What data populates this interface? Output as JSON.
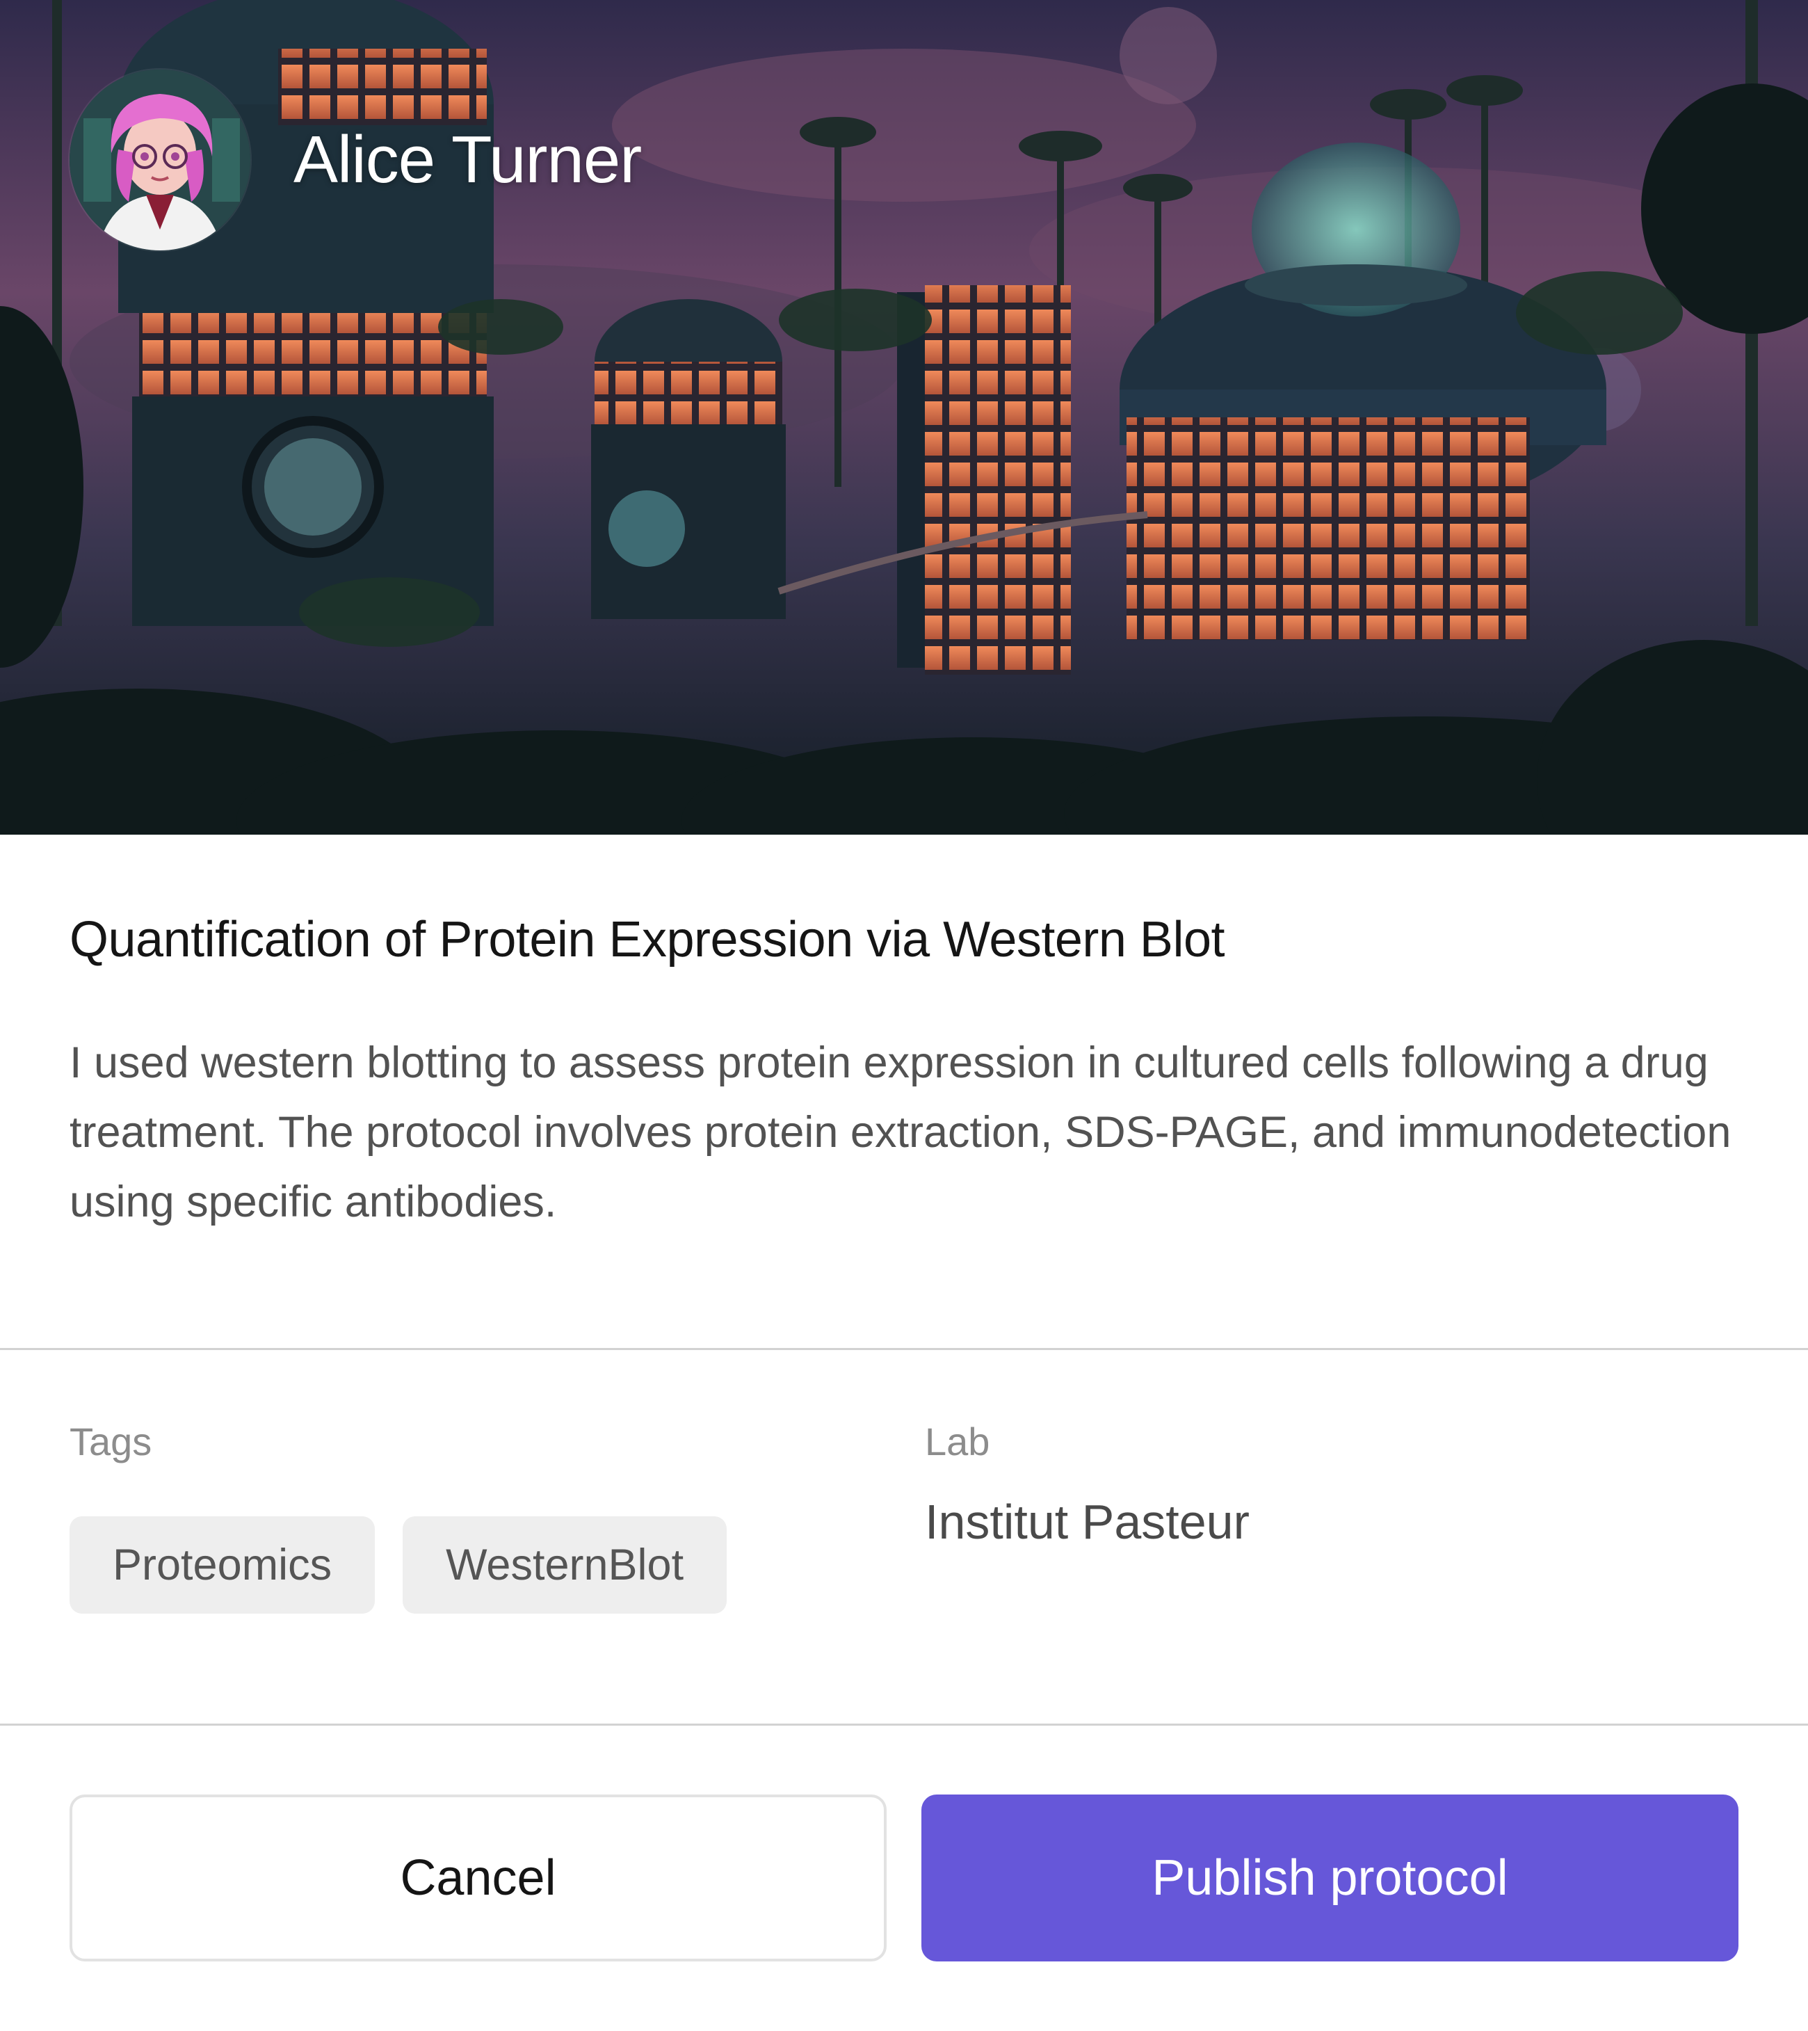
{
  "author": {
    "name": "Alice Turner",
    "avatar_icon": "scientist-avatar"
  },
  "hero": {
    "image_icon": "futuristic-lab-illustration"
  },
  "protocol": {
    "title": "Quantification of Protein Expression via Western Blot",
    "description": "I used western blotting to assess protein expression in cultured cells following a drug treatment. The protocol involves protein extraction, SDS-PAGE, and immunodetection using specific antibodies."
  },
  "tags": {
    "label": "Tags",
    "items": [
      "Proteomics",
      "WesternBlot"
    ]
  },
  "lab": {
    "label": "Lab",
    "value": "Institut Pasteur"
  },
  "actions": {
    "cancel_label": "Cancel",
    "publish_label": "Publish protocol"
  },
  "colors": {
    "primary": "#6657d9",
    "tag_background": "#eeeeee",
    "divider": "#d2d2d2"
  }
}
